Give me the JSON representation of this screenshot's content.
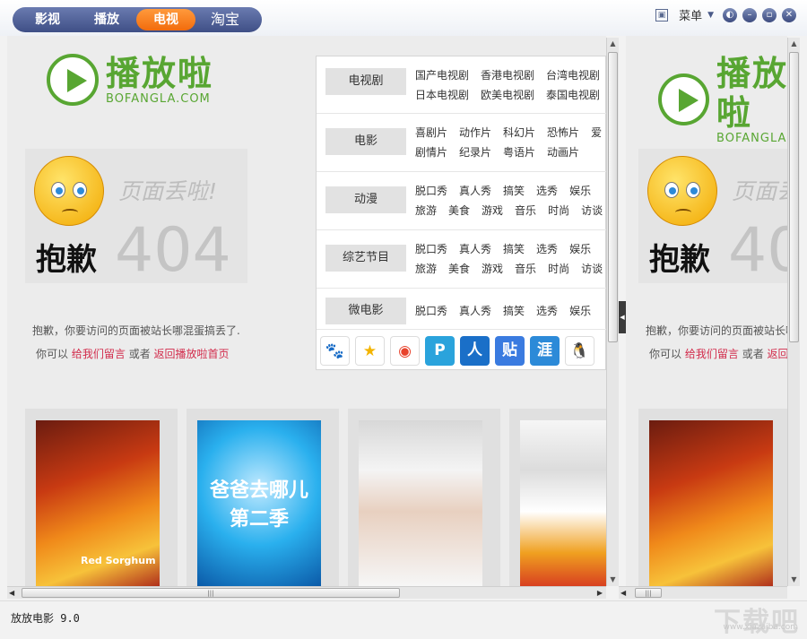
{
  "tabs": [
    {
      "label": "影视",
      "active": false
    },
    {
      "label": "播放",
      "active": false
    },
    {
      "label": "电视",
      "active": true
    },
    {
      "label": "淘宝",
      "active": false
    }
  ],
  "toolbar": {
    "menu_label": "菜单",
    "skin_icon": "skin-icon",
    "window_icons": [
      "pin-icon",
      "minimize-icon",
      "maximize-icon",
      "close-icon"
    ]
  },
  "brand": {
    "logo_big": "播放啦",
    "logo_small": "BOFANGLA.COM"
  },
  "error": {
    "lost_text": "页面丢啦!",
    "sorry_text": "抱歉",
    "code": "404",
    "message": "抱歉，你要访问的页面被站长哪混蛋搞丢了.",
    "alt_prefix": "你可以",
    "link_message": "给我们留言",
    "alt_or": "或者",
    "link_home": "返回播放啦首页"
  },
  "dropdown": {
    "categories": [
      {
        "name": "电视剧",
        "links": [
          [
            "国产电视剧",
            "香港电视剧",
            "台湾电视剧"
          ],
          [
            "日本电视剧",
            "欧美电视剧",
            "泰国电视剧"
          ]
        ]
      },
      {
        "name": "电影",
        "links": [
          [
            "喜剧片",
            "动作片",
            "科幻片",
            "恐怖片",
            "爱"
          ],
          [
            "剧情片",
            "纪录片",
            "粤语片",
            "动画片"
          ]
        ]
      },
      {
        "name": "动漫",
        "links": [
          [
            "脱口秀",
            "真人秀",
            "搞笑",
            "选秀",
            "娱乐"
          ],
          [
            "旅游",
            "美食",
            "游戏",
            "音乐",
            "时尚",
            "访谈"
          ]
        ]
      },
      {
        "name": "综艺节目",
        "links": [
          [
            "脱口秀",
            "真人秀",
            "搞笑",
            "选秀",
            "娱乐"
          ],
          [
            "旅游",
            "美食",
            "游戏",
            "音乐",
            "时尚",
            "访谈"
          ]
        ]
      },
      {
        "name": "微电影",
        "links": [
          [
            "脱口秀",
            "真人秀",
            "搞笑",
            "选秀",
            "娱乐"
          ]
        ]
      }
    ],
    "share_icons": [
      {
        "name": "baidu-icon",
        "glyph": "🐾",
        "color": "#2f6fd8"
      },
      {
        "name": "qzone-icon",
        "glyph": "★",
        "color": "#f3b400"
      },
      {
        "name": "weibo-icon",
        "glyph": "◉",
        "color": "#e8432c"
      },
      {
        "name": "tencent-weibo-icon",
        "glyph": "P",
        "color": "#2aa3dc"
      },
      {
        "name": "renren-icon",
        "glyph": "人",
        "color": "#1a6fc8"
      },
      {
        "name": "tieba-icon",
        "glyph": "贴",
        "color": "#3a7be0"
      },
      {
        "name": "kaixin-icon",
        "glyph": "涯",
        "color": "#2c8ad8"
      },
      {
        "name": "qq-icon",
        "glyph": "🐧",
        "color": "#f2f2f2"
      }
    ]
  },
  "posters": [
    {
      "name": "poster-red-sorghum",
      "overlay": "Red Sorghum"
    },
    {
      "name": "poster-dad-where-are-we-going",
      "overlay": "爸爸去哪儿 第二季"
    },
    {
      "name": "poster-iu",
      "overlay": ""
    },
    {
      "name": "poster-variety-show",
      "overlay": ""
    }
  ],
  "status": {
    "version": "放放电影 9.0",
    "watermark": "下载吧",
    "watermark_url": "www.xiazaiba.com"
  }
}
